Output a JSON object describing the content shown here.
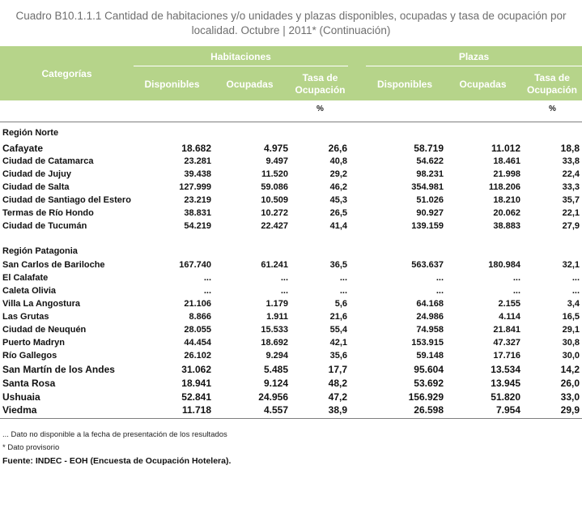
{
  "title": {
    "line1": "Cuadro B10.1.1.1 Cantidad de habitaciones y/o unidades y plazas disponibles, ocupadas y tasa de ocupación por",
    "line2": "localidad. Octubre | 2011* (Continuación)"
  },
  "header": {
    "categorias": "Categorías",
    "habitaciones": "Habitaciones",
    "plazas": "Plazas",
    "disponibles": "Disponibles",
    "ocupadas": "Ocupadas",
    "tasa_line1": "Tasa de",
    "tasa_line2": "Ocupación",
    "pct": "%"
  },
  "regions": [
    {
      "name": "Región Norte",
      "rows": [
        [
          "Cafayate",
          "18.682",
          "4.975",
          "26,6",
          "58.719",
          "11.012",
          "18,8"
        ],
        [
          "Ciudad de Catamarca",
          "23.281",
          "9.497",
          "40,8",
          "54.622",
          "18.461",
          "33,8"
        ],
        [
          "Ciudad de Jujuy",
          "39.438",
          "11.520",
          "29,2",
          "98.231",
          "21.998",
          "22,4"
        ],
        [
          "Ciudad de Salta",
          "127.999",
          "59.086",
          "46,2",
          "354.981",
          "118.206",
          "33,3"
        ],
        [
          "Ciudad de Santiago del Estero",
          "23.219",
          "10.509",
          "45,3",
          "51.026",
          "18.210",
          "35,7"
        ],
        [
          "Termas de Río Hondo",
          "38.831",
          "10.272",
          "26,5",
          "90.927",
          "20.062",
          "22,1"
        ],
        [
          "Ciudad de Tucumán",
          "54.219",
          "22.427",
          "41,4",
          "139.159",
          "38.883",
          "27,9"
        ]
      ]
    },
    {
      "name": "Región Patagonia",
      "rows": [
        [
          "San Carlos de Bariloche",
          "167.740",
          "61.241",
          "36,5",
          "563.637",
          "180.984",
          "32,1"
        ],
        [
          "El Calafate",
          "...",
          "...",
          "...",
          "...",
          "...",
          "..."
        ],
        [
          "Caleta Olivia",
          "...",
          "...",
          "...",
          "...",
          "...",
          "..."
        ],
        [
          "Villa La Angostura",
          "21.106",
          "1.179",
          "5,6",
          "64.168",
          "2.155",
          "3,4"
        ],
        [
          "Las Grutas",
          "8.866",
          "1.911",
          "21,6",
          "24.986",
          "4.114",
          "16,5"
        ],
        [
          "Ciudad de Neuquén",
          "28.055",
          "15.533",
          "55,4",
          "74.958",
          "21.841",
          "29,1"
        ],
        [
          "Puerto Madryn",
          "44.454",
          "18.692",
          "42,1",
          "153.915",
          "47.327",
          "30,8"
        ],
        [
          "Río Gallegos",
          "26.102",
          "9.294",
          "35,6",
          "59.148",
          "17.716",
          "30,0"
        ],
        [
          "San Martín de los Andes",
          "31.062",
          "5.485",
          "17,7",
          "95.604",
          "13.534",
          "14,2"
        ],
        [
          "Santa Rosa",
          "18.941",
          "9.124",
          "48,2",
          "53.692",
          "13.945",
          "26,0"
        ],
        [
          "Ushuaia",
          "52.841",
          "24.956",
          "47,2",
          "156.929",
          "51.820",
          "33,0"
        ],
        [
          "Viedma",
          "11.718",
          "4.557",
          "38,9",
          "26.598",
          "7.954",
          "29,9"
        ]
      ]
    }
  ],
  "notes": {
    "no_disponible": "... Dato no disponible a la fecha de presentación de los resultados",
    "provisorio": "* Dato provisorio",
    "fuente": "Fuente: INDEC - EOH (Encuesta de Ocupación Hotelera)."
  }
}
